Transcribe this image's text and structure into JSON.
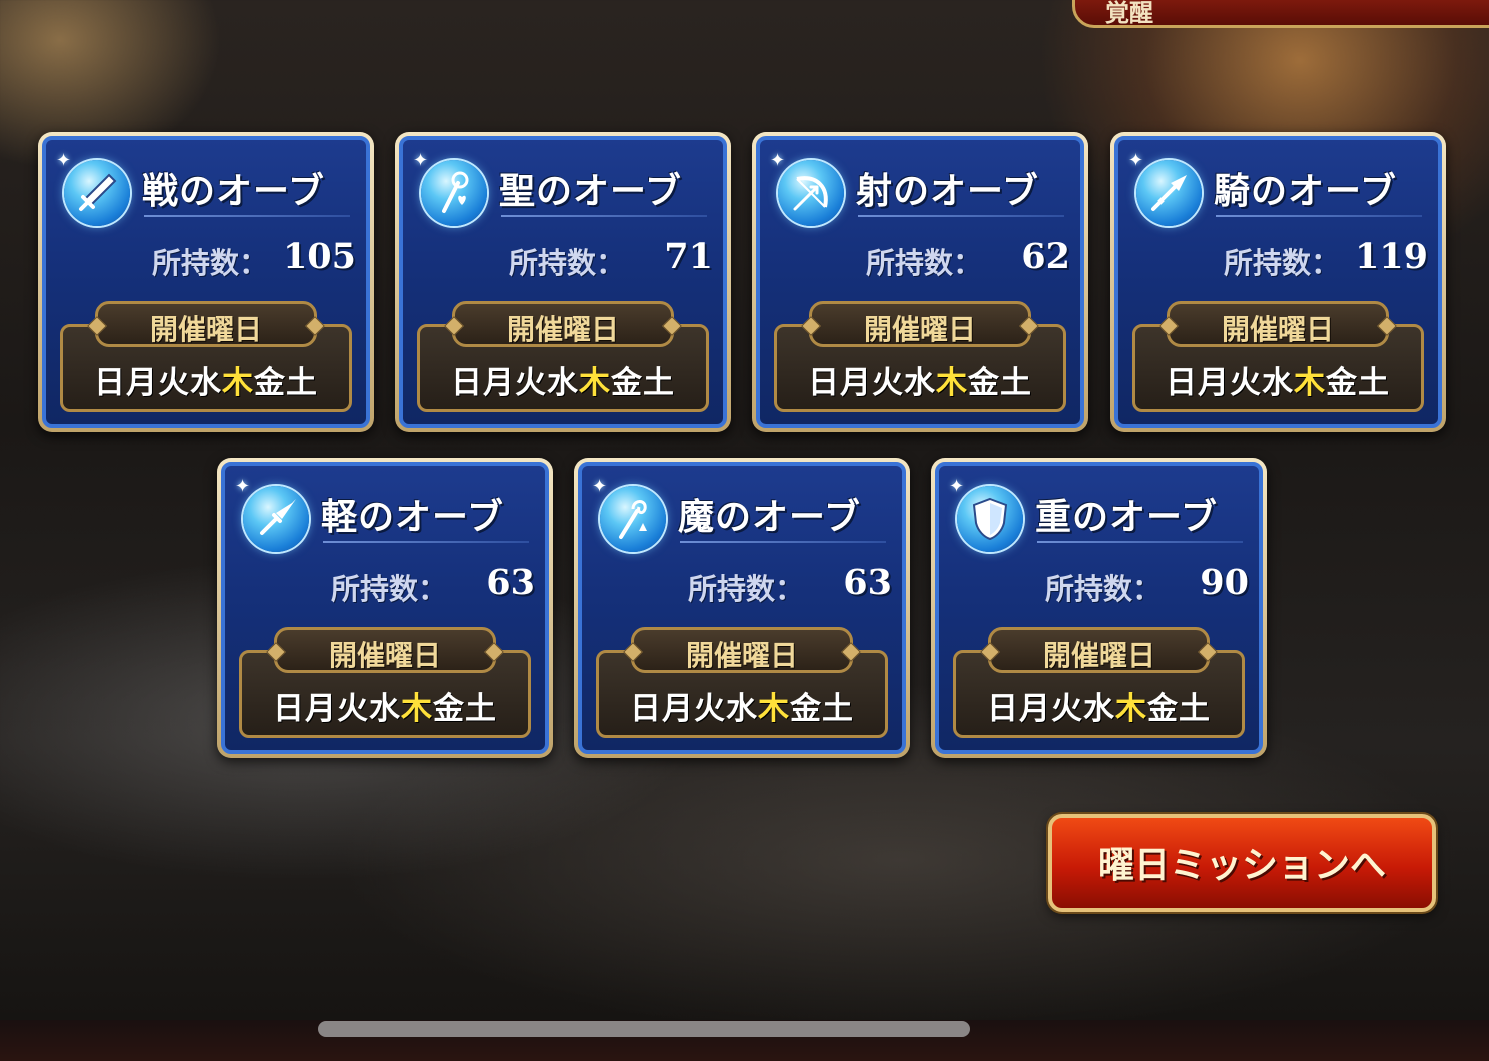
{
  "header": {
    "banner_text": "覚醒"
  },
  "labels": {
    "count_label": "所持数：",
    "schedule_title": "開催曜日",
    "days_before": "日月火水",
    "days_highlight": "木",
    "days_after": "金土"
  },
  "colors": {
    "highlight_day": "#ffe13a",
    "panel_blue": "#1d3b8e",
    "button_red": "#c81a06"
  },
  "orbs": [
    {
      "title": "戦のオーブ",
      "count": "105",
      "icon": "sword-icon"
    },
    {
      "title": "聖のオーブ",
      "count": "71",
      "icon": "staff-heart-icon"
    },
    {
      "title": "射のオーブ",
      "count": "62",
      "icon": "bow-icon"
    },
    {
      "title": "騎のオーブ",
      "count": "119",
      "icon": "lance-icon"
    },
    {
      "title": "軽のオーブ",
      "count": "63",
      "icon": "dagger-icon"
    },
    {
      "title": "魔のオーブ",
      "count": "63",
      "icon": "magic-staff-icon"
    },
    {
      "title": "重のオーブ",
      "count": "90",
      "icon": "shield-icon"
    }
  ],
  "mission_button": {
    "label": "曜日ミッションへ"
  }
}
